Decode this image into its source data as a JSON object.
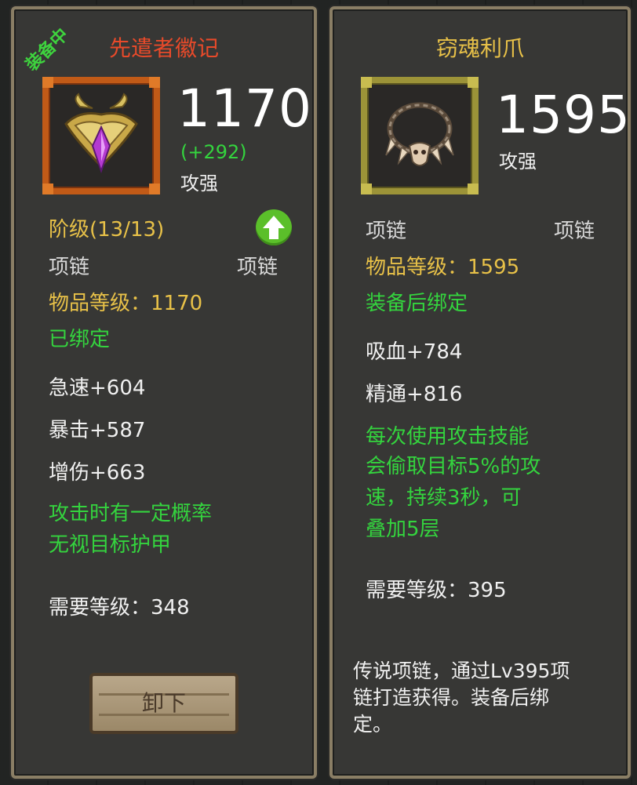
{
  "left": {
    "badge": "装备中",
    "title": "先遣者徽记",
    "icon": "horned-amulet-icon",
    "power": "1170",
    "power_diff": "(+292)",
    "power_label": "攻强",
    "rank": "阶级(13/13)",
    "slot_left": "项链",
    "slot_right": "项链",
    "item_level": "物品等级：1170",
    "bind": "已绑定",
    "stats": [
      "急速+604",
      "暴击+587",
      "增伤+663"
    ],
    "effect_lines": [
      "攻击时有一定概率",
      "无视目标护甲"
    ],
    "required_level": "需要等级：348",
    "unequip_button": "卸下"
  },
  "right": {
    "title": "窃魂利爪",
    "icon": "claw-necklace-icon",
    "power": "1595",
    "power_label": "攻强",
    "slot_left": "项链",
    "slot_right": "项链",
    "item_level": "物品等级：1595",
    "bind": "装备后绑定",
    "stats": [
      "吸血+784",
      "精通+816"
    ],
    "effect_lines": [
      "每次使用攻击技能",
      "会偷取目标5%的攻",
      "速，持续3秒，可",
      "叠加5层"
    ],
    "required_level": "需要等级：395",
    "description_lines": [
      "传说项链，通过Lv395项",
      "链打造获得。装备后绑",
      "定。"
    ]
  },
  "colors": {
    "title_left": "#e84a2a",
    "title_right": "#e8c148",
    "gold": "#e8c148",
    "green": "#34d43e",
    "text": "#f0f0f0"
  }
}
